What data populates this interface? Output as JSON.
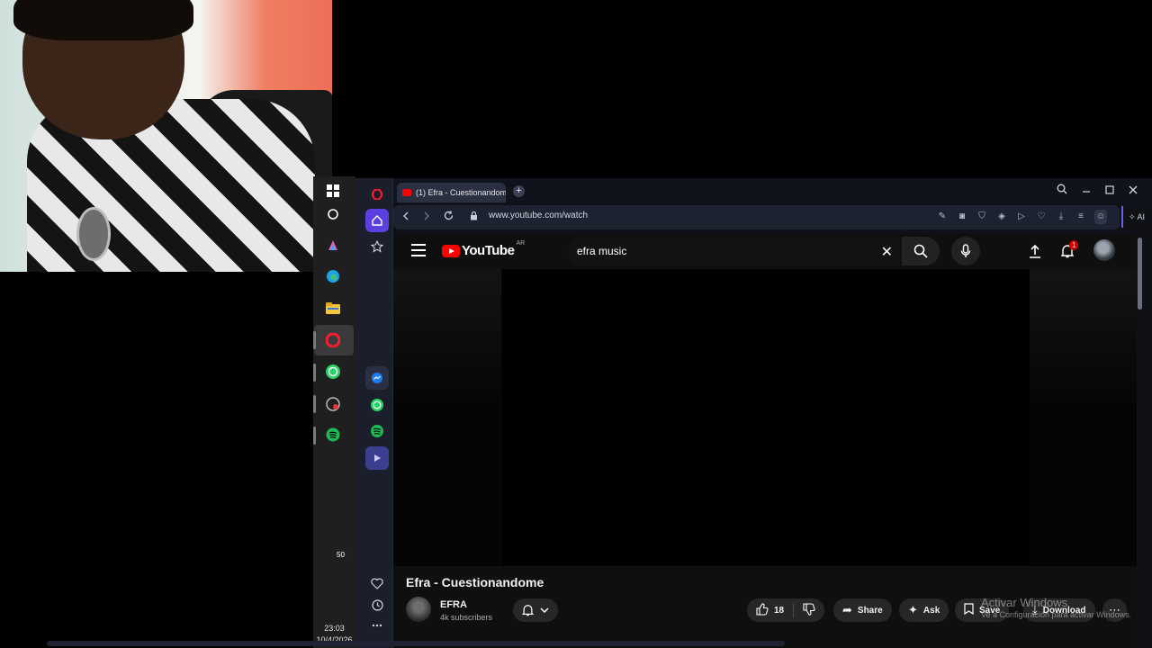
{
  "taskbar": {
    "time": "23:03",
    "date": "10/4/2026",
    "whatsapp_badge": "50",
    "icons": [
      "windows-start-icon",
      "search-icon",
      "copilot-icon",
      "edge-icon",
      "file-explorer-icon",
      "opera-icon",
      "whatsapp-icon",
      "chrome-icon",
      "spotify-icon"
    ]
  },
  "browser": {
    "tab_title": "(1) Efra - Cuestionandome",
    "new_tab": "+",
    "url": "www.youtube.com/watch",
    "ai_label": "AI",
    "sidebar_icons": [
      "opera-logo-icon",
      "home-icon",
      "star-icon",
      "messenger-icon",
      "whatsapp-icon",
      "spotify-icon",
      "player-icon",
      "heart-icon",
      "history-icon",
      "more-icon"
    ]
  },
  "youtube": {
    "logo_text": "YouTube",
    "region": "AR",
    "search_query": "efra music",
    "notification_count": "1",
    "video_title": "Efra - Cuestionandome",
    "channel_name": "EFRA",
    "subscribers": "4k subscribers",
    "likes": "18",
    "share_label": "Share",
    "ask_label": "Ask",
    "save_label": "Save",
    "download_label": "Download"
  },
  "watermark": {
    "line1": "Activar Windows",
    "line2": "Ve a Configuración para activar Windows."
  },
  "colors": {
    "youtube_red": "#ff0000",
    "opera_accent": "#6c5ce7",
    "page_bg": "#0f0f0f"
  }
}
